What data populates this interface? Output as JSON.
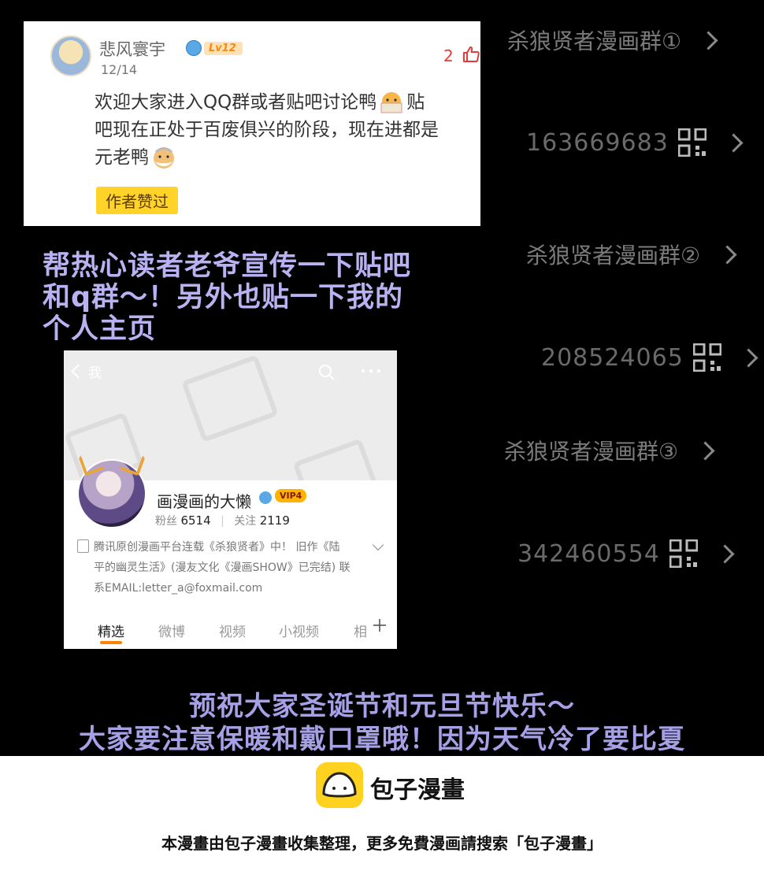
{
  "comment": {
    "username": "悲风寰宇",
    "level": "Lv12",
    "date": "12/14",
    "likes": "2",
    "body_line1": "欢迎大家进入QQ群或者贴吧讨论鸭",
    "body_line2": "贴",
    "body_line3": "吧现在正处于百废俱兴的阶段，现在进都是",
    "body_line4": "元老鸭",
    "author_tag": "作者赞过"
  },
  "caption_top": [
    "帮热心读者老爷宣传一下贴吧",
    "和q群～！另外也贴一下我的",
    "个人主页"
  ],
  "profile": {
    "back_label": "我",
    "name": "画漫画的大懒",
    "vip": "VIP4",
    "fans_label": "粉丝",
    "fans": "6514",
    "follow_label": "关注",
    "follow": "2119",
    "bio_line1": "腾讯原创漫画平台连载《杀狼贤者》中！ 旧作《陆",
    "bio_line2": "平的幽灵生活》(漫友文化《漫画SHOW》已完结) 联",
    "bio_line3": "系EMAIL:letter_a@foxmail.com",
    "tabs": [
      "精选",
      "微博",
      "视频",
      "小视频",
      "相"
    ]
  },
  "qq_groups": [
    {
      "label": "杀狼贤者漫画群①"
    },
    {
      "number": "163669683"
    },
    {
      "label": "杀狼贤者漫画群②"
    },
    {
      "number": "208524065"
    },
    {
      "label": "杀狼贤者漫画群③"
    },
    {
      "number": "342460554"
    }
  ],
  "caption_bottom": [
    "预祝大家圣诞节和元旦节快乐～",
    "大家要注意保暖和戴口罩哦！因为天气冷了要比夏"
  ],
  "footer": {
    "brand": "包子漫畫",
    "notice": "本漫畫由包子漫畫收集整理，更多免費漫画請搜索「包子漫畫」"
  },
  "colors": {
    "caption": "#b9b2f2",
    "like": "#e33a3a",
    "tag": "#ffd328",
    "tab_accent": "#ff8200",
    "logo": "#ffd21f"
  }
}
